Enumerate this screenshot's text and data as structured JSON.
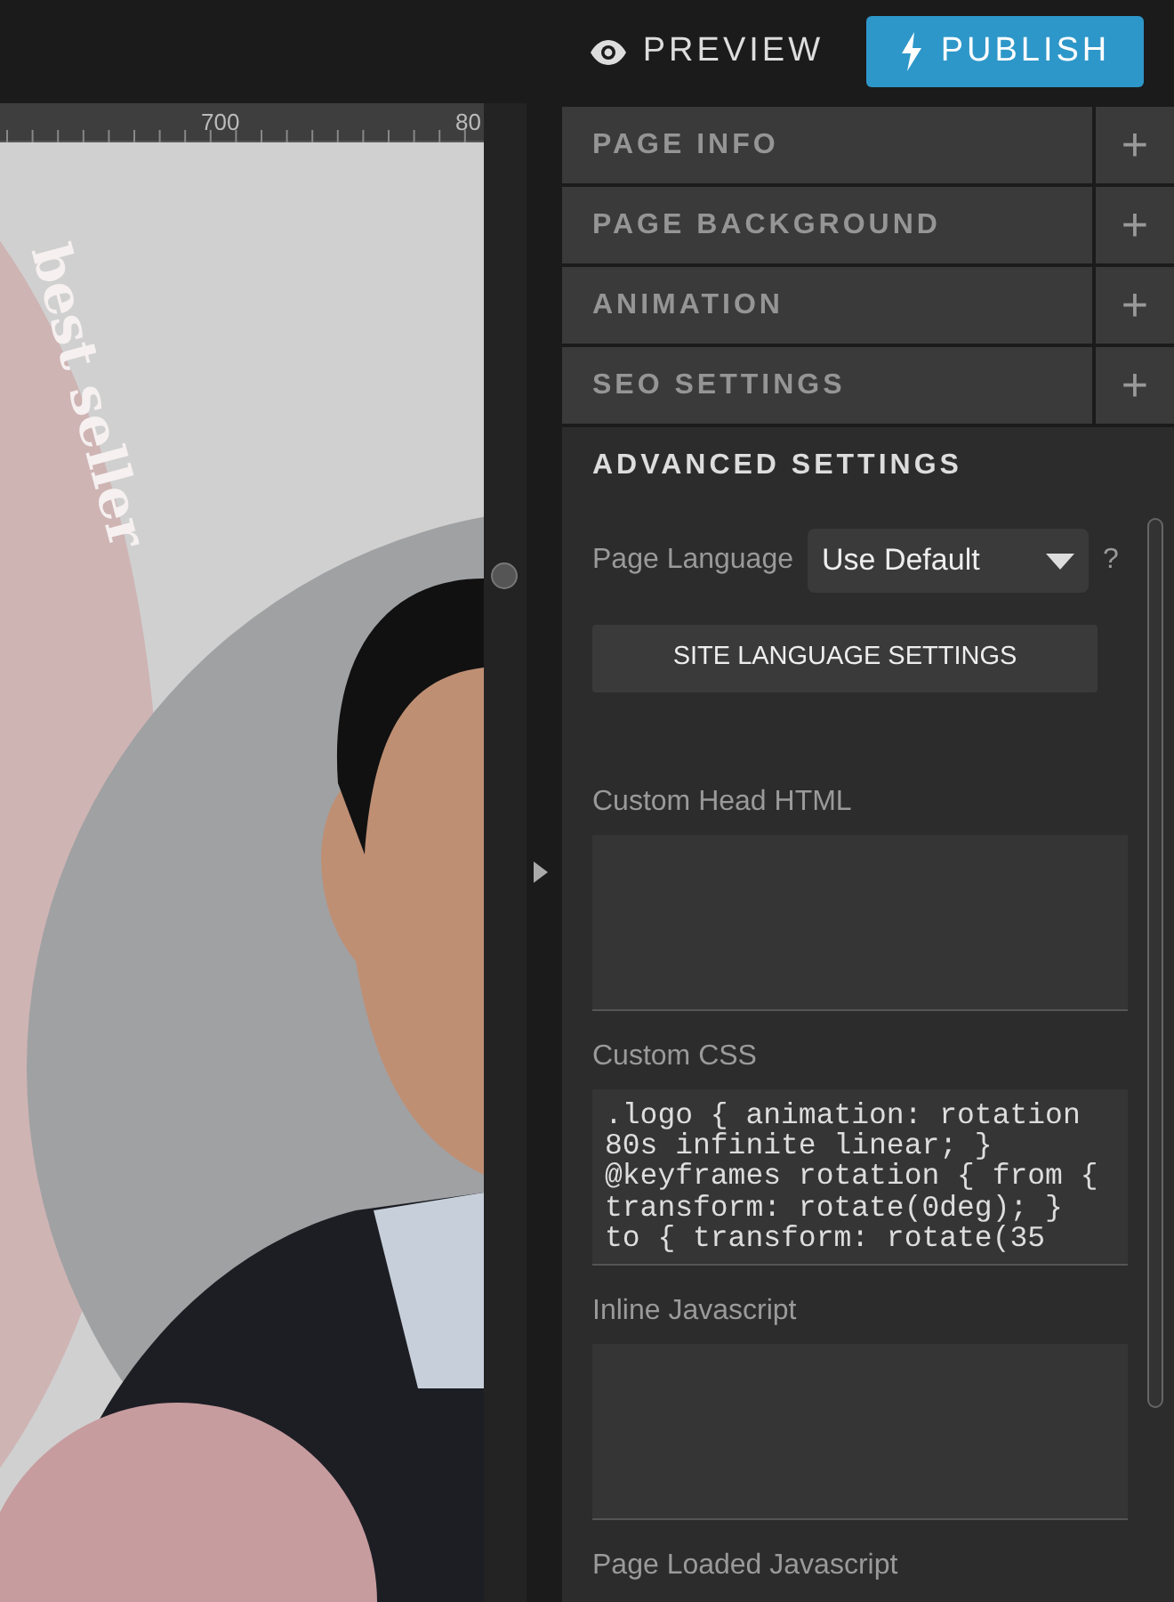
{
  "topbar": {
    "preview": "PREVIEW",
    "publish": "PUBLISH"
  },
  "ruler": {
    "labels": [
      "700",
      "80"
    ]
  },
  "canvas": {
    "logo_text": "best seller"
  },
  "sections": [
    {
      "title": "PAGE INFO",
      "expanded": false,
      "toggle": "+"
    },
    {
      "title": "PAGE BACKGROUND",
      "expanded": false,
      "toggle": "+"
    },
    {
      "title": "ANIMATION",
      "expanded": false,
      "toggle": "+"
    },
    {
      "title": "SEO SETTINGS",
      "expanded": false,
      "toggle": "+"
    },
    {
      "title": "ADVANCED SETTINGS",
      "expanded": true
    }
  ],
  "advanced": {
    "language_label": "Page Language",
    "language_value": "Use Default",
    "help": "?",
    "site_language_button": "SITE LANGUAGE SETTINGS",
    "fields": [
      {
        "label": "Custom Head HTML"
      },
      {
        "label": "Custom CSS",
        "lines": [
          ".logo { animation: rotation",
          "80s infinite linear; }",
          "@keyframes rotation { from {",
          "transform: rotate(0deg); }",
          "to { transform: rotate(35"
        ]
      },
      {
        "label": "Inline Javascript"
      },
      {
        "label": "Page Loaded Javascript"
      }
    ]
  }
}
